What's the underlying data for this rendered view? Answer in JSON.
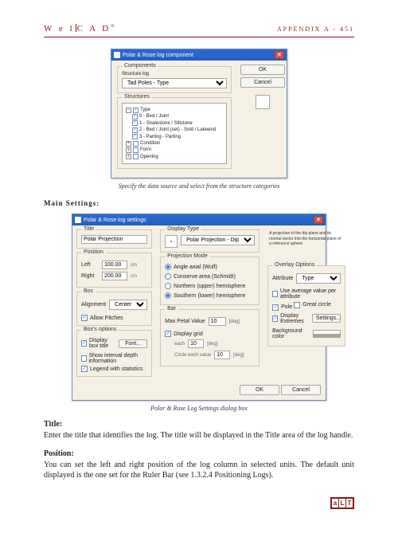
{
  "header": {
    "brand": "W e l|C A D",
    "page_no": "APPENDIX A - 451"
  },
  "dialog1": {
    "title": "Polar & Rose log component",
    "group_components": "Components",
    "label_structure_log": "Structure log",
    "source_value": "Tad Poles - Type",
    "group_structures": "Structures",
    "tree": [
      {
        "level": 1,
        "pm": "-",
        "checked": true,
        "label": "Type"
      },
      {
        "level": 2,
        "pm": "",
        "checked": true,
        "label": "0 - Bed / Joint"
      },
      {
        "level": 2,
        "pm": "",
        "checked": true,
        "label": "1 - Shalestone / Siltstone"
      },
      {
        "level": 2,
        "pm": "",
        "checked": true,
        "label": "2 - Bed / Joint (set) - Sold / Lakeend"
      },
      {
        "level": 2,
        "pm": "",
        "checked": true,
        "label": "3 - Parting - Parting"
      },
      {
        "level": 1,
        "pm": "+",
        "checked": false,
        "label": "Condition"
      },
      {
        "level": 1,
        "pm": "+",
        "checked": false,
        "label": "Form"
      },
      {
        "level": 1,
        "pm": "+",
        "checked": false,
        "label": "Opening"
      }
    ],
    "btn_ok": "OK",
    "btn_cancel": "Cancel"
  },
  "caption1": "Specify the data source and select from the structure categories",
  "section_main": "Main Settings:",
  "dialog2": {
    "title": "Polar & Rose log settings",
    "groups": {
      "title": "Title",
      "position": "Position",
      "box": "Box",
      "box_options": "Box's options",
      "display_type": "Display Type",
      "projection_mode": "Projection Mode",
      "bar": "Bar",
      "overlay": "Overlay Options"
    },
    "title_value": "Polar Projection",
    "pos_left_label": "Left",
    "pos_right_label": "Right",
    "pos_left": "100.00",
    "pos_right": "200.00",
    "pos_units": "cm",
    "alignment_label": "Alignment",
    "alignment_value": "Center",
    "allow_pitches": "Allow Pitches",
    "display_box_title": "Display box title",
    "font_btn": "Font...",
    "show_interval": "Show interval depth information",
    "legend_stats": "Legend with statistics",
    "display_type_value": "Polar Projection - Dip",
    "disp_note": "A projection of the dip plane and its normal vector into the horizontal plane of a reference sphere",
    "proj_angle": "Angle axial (Wulf)",
    "proj_conserve": "Conserve area (Schmidt)",
    "proj_northern": "Northern (upper) hemisphere",
    "proj_southern": "Southern (lower) hemisphere",
    "max_petal_label": "Max Petal Value",
    "max_petal_value": "10",
    "max_petal_units": "[deg]",
    "display_grid": "Display grid",
    "grid_label_each": "each",
    "grid_each_val": "10",
    "circle_each_val": "10",
    "grid_units": "[deg]",
    "circle_units": "[deg]",
    "circle_label": "Circle each value",
    "attribute_label": "Attribute",
    "attribute_value": "Type",
    "use_average": "Use average value per attribute",
    "pole": "Pole",
    "great_circle": "Great circle",
    "display_extremes": "Display Extremes",
    "settings_btn": "Settings...",
    "bg_color_label": "Background color",
    "btn_ok": "OK",
    "btn_cancel": "Cancel"
  },
  "caption2": "Polar & Rose Log Settings dialog box",
  "body": {
    "h_title": "Title:",
    "p_title": "Enter the title that identifies the log. The title will be displayed in the Title area of the log handle.",
    "h_position": "Position:",
    "p_position": "You can set the left and right position of the log column in selected units. The default unit displayed is the one set for the Ruler Bar (see 1.3.2.4 Positioning Logs)."
  },
  "footer_logo": [
    "a",
    "L",
    "T"
  ]
}
